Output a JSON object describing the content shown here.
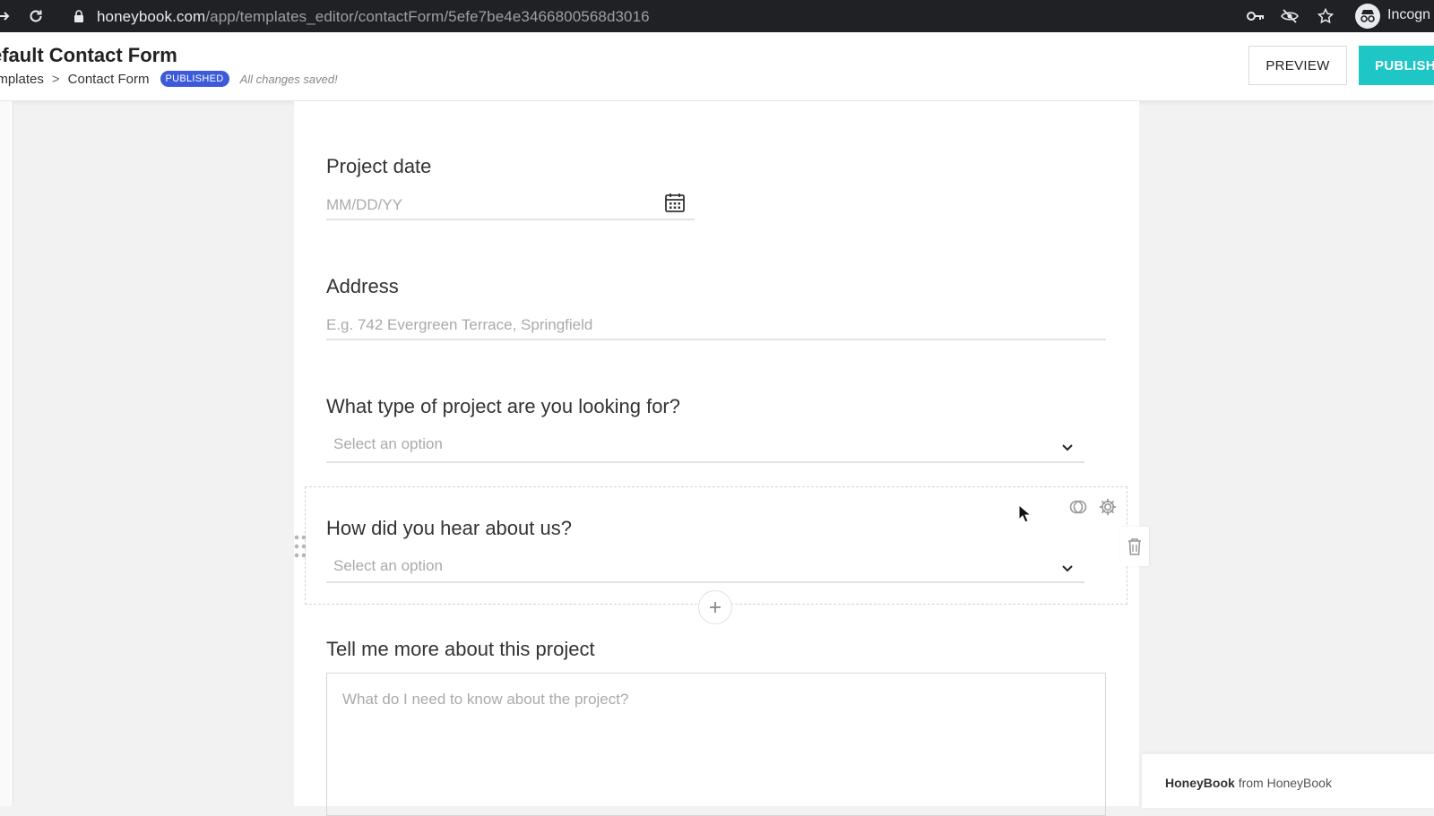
{
  "browser": {
    "url_host": "honeybook.com",
    "url_path": "/app/templates_editor/contactForm/5efe7be4e3466800568d3016",
    "profile_label": "Incogn"
  },
  "header": {
    "title": "efault Contact Form",
    "breadcrumb": {
      "parent": "emplates",
      "separator": ">",
      "current": "Contact Form"
    },
    "status_badge": "PUBLISHED",
    "save_status": "All changes saved!",
    "preview_label": "PREVIEW",
    "publish_label": "PUBLISH"
  },
  "form": {
    "fields": [
      {
        "label": "Project date",
        "placeholder": "MM/DD/YY",
        "type": "date"
      },
      {
        "label": "Address",
        "placeholder": "E.g. 742 Evergreen Terrace, Springfield",
        "type": "text"
      },
      {
        "label": "What type of project are you looking for?",
        "placeholder": "Select an option",
        "type": "select"
      },
      {
        "label": "How did you hear about us?",
        "placeholder": "Select an option",
        "type": "select",
        "selected": true
      },
      {
        "label": "Tell me more about this project",
        "placeholder": "What do I need to know about the project?",
        "type": "textarea"
      }
    ]
  },
  "footer": {
    "brand": "HoneyBook",
    "suffix": "from HoneyBook"
  },
  "colors": {
    "accent": "#1ec6c6",
    "badge": "#3d5bd9"
  }
}
